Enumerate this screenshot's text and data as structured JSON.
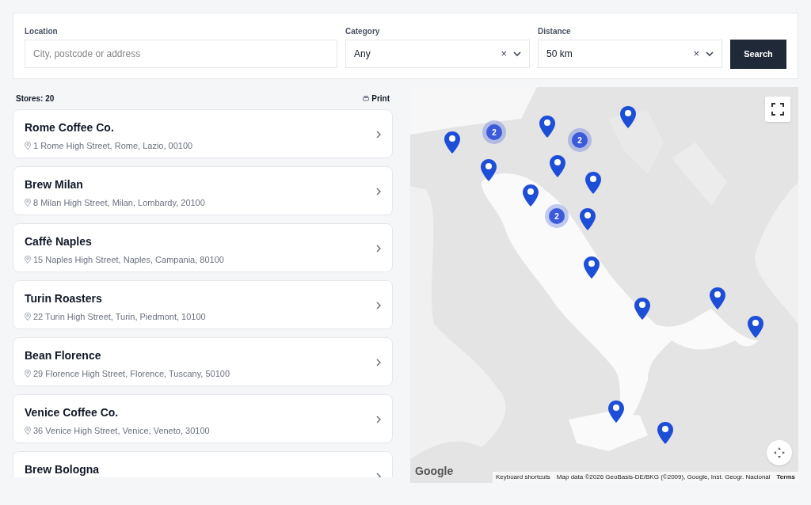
{
  "filters": {
    "location": {
      "label": "Location",
      "placeholder": "City, postcode or address"
    },
    "category": {
      "label": "Category",
      "value": "Any",
      "clear": "×"
    },
    "distance": {
      "label": "Distance",
      "value": "50 km",
      "clear": "×"
    },
    "search_button": "Search"
  },
  "list": {
    "count": "Stores: 20",
    "print": "Print"
  },
  "stores": [
    {
      "name": "Rome Coffee Co.",
      "address": "1 Rome High Street, Rome, Lazio, 00100"
    },
    {
      "name": "Brew Milan",
      "address": "8 Milan High Street, Milan, Lombardy, 20100"
    },
    {
      "name": "Caffè Naples",
      "address": "15 Naples High Street, Naples, Campania, 80100"
    },
    {
      "name": "Turin Roasters",
      "address": "22 Turin High Street, Turin, Piedmont, 10100"
    },
    {
      "name": "Bean Florence",
      "address": "29 Florence High Street, Florence, Tuscany, 50100"
    },
    {
      "name": "Venice Coffee Co.",
      "address": "36 Venice High Street, Venice, Veneto, 30100"
    },
    {
      "name": "Brew Bologna"
    }
  ],
  "map": {
    "kind": "picture",
    "clusters": [
      {
        "count": "2"
      },
      {
        "count": "2"
      },
      {
        "count": "2"
      }
    ],
    "logo": "Google",
    "attribution": [
      "Keyboard shortcuts",
      "Map data ©2026 GeoBasis-DE/BKG (©2009), Google, Inst. Geogr. Nacional",
      "Terms"
    ]
  }
}
